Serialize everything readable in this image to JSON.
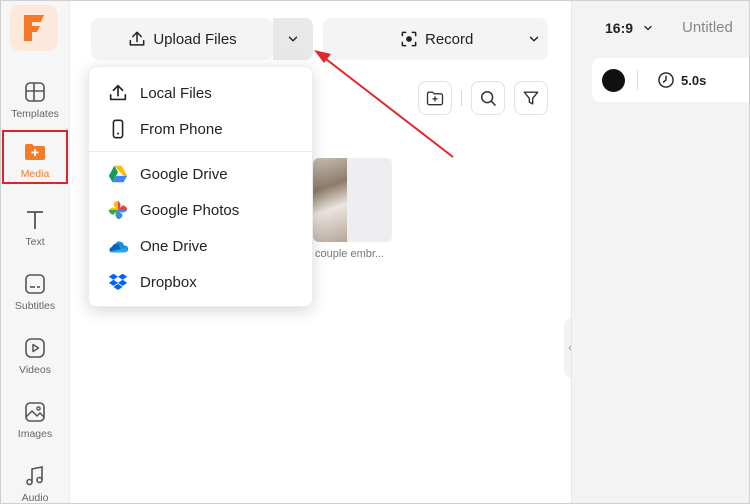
{
  "sidebar": {
    "logo_icon": "filmora-f-logo",
    "items": [
      {
        "label": "Templates",
        "icon": "templates-icon"
      },
      {
        "label": "Media",
        "icon": "media-folder-icon",
        "active": true
      },
      {
        "label": "Text",
        "icon": "text-icon"
      },
      {
        "label": "Subtitles",
        "icon": "subtitles-icon"
      },
      {
        "label": "Videos",
        "icon": "videos-icon"
      },
      {
        "label": "Images",
        "icon": "images-icon"
      },
      {
        "label": "Audio",
        "icon": "audio-icon"
      }
    ]
  },
  "toolbar": {
    "upload_label": "Upload Files",
    "record_label": "Record"
  },
  "upload_menu": {
    "items": [
      {
        "label": "Local Files",
        "icon": "upload-icon"
      },
      {
        "label": "From Phone",
        "icon": "phone-icon"
      },
      {
        "label": "Google Drive",
        "icon": "google-drive-icon"
      },
      {
        "label": "Google Photos",
        "icon": "google-photos-icon"
      },
      {
        "label": "One Drive",
        "icon": "onedrive-icon"
      },
      {
        "label": "Dropbox",
        "icon": "dropbox-icon"
      }
    ]
  },
  "media": {
    "thumbnail_caption": "couple embr..."
  },
  "preview": {
    "aspect_ratio": "16:9",
    "title": "Untitled",
    "duration": "5.0s"
  },
  "colors": {
    "accent": "#f47b2a",
    "highlight_box": "#d7262c",
    "annotation_arrow": "#e3262b"
  }
}
